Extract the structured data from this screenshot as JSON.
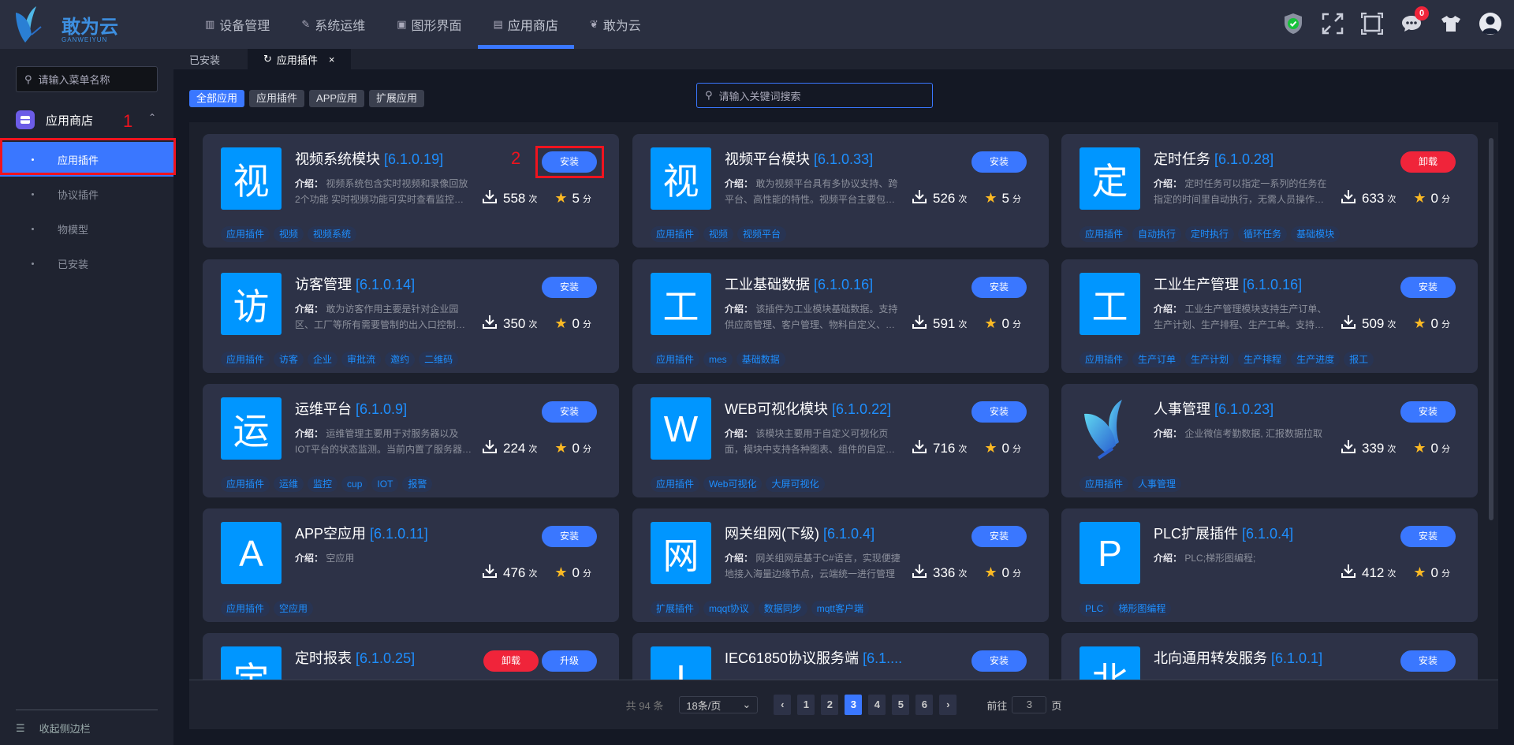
{
  "header": {
    "logo_text": "敢为云",
    "logo_sub": "GANWEIYUN",
    "nav": [
      {
        "label": "设备管理",
        "icon": "device-icon",
        "glyph": "▥"
      },
      {
        "label": "系统运维",
        "icon": "wrench-icon",
        "glyph": "✎"
      },
      {
        "label": "图形界面",
        "icon": "monitor-icon",
        "glyph": "▣"
      },
      {
        "label": "应用商店",
        "icon": "store-icon",
        "glyph": "▤",
        "active": true
      },
      {
        "label": "敢为云",
        "icon": "butterfly-icon",
        "glyph": "❦"
      }
    ],
    "message_count": "0",
    "colors": {
      "accent": "#3a77ff",
      "danger": "#f0243a",
      "tag_text": "#1e8fff",
      "icon_bg": "#0096ff"
    }
  },
  "sidebar": {
    "search_placeholder": "请输入菜单名称",
    "group": "应用商店",
    "items": [
      {
        "label": "应用插件",
        "active": true
      },
      {
        "label": "协议插件"
      },
      {
        "label": "物模型"
      },
      {
        "label": "已安装"
      }
    ],
    "collapse_label": "收起侧边栏"
  },
  "annotations": {
    "one": "1",
    "two": "2"
  },
  "tabs": [
    {
      "label": "已安装"
    },
    {
      "label": "应用插件",
      "active": true
    }
  ],
  "filters": [
    "全部应用",
    "应用插件",
    "APP应用",
    "扩展应用"
  ],
  "search_placeholder": "请输入关键词搜索",
  "labels": {
    "intro": "介绍：",
    "times": "次",
    "score": "分",
    "install": "安装",
    "uninstall": "卸载",
    "upgrade": "升级"
  },
  "plugins": [
    {
      "icon": "视",
      "name": "视频系统模块",
      "version": "[6.1.0.19]",
      "desc": "视频系统包含实时视频和录像回放2个功能 实时视频功能可实时查看监控视频画面",
      "downloads": "558",
      "rating": "5",
      "buttons": [
        "安装"
      ],
      "tags": [
        "应用插件",
        "视频",
        "视频系统"
      ]
    },
    {
      "icon": "视",
      "name": "视频平台模块",
      "version": "[6.1.0.33]",
      "desc": "敢为视频平台具有多协议支持、跨平台、高性能的特性。视频平台主要包含多个模块",
      "downloads": "526",
      "rating": "5",
      "buttons": [
        "安装"
      ],
      "tags": [
        "应用插件",
        "视频",
        "视频平台"
      ]
    },
    {
      "icon": "定",
      "name": "定时任务",
      "version": "[6.1.0.28]",
      "desc": "定时任务可以指定一系列的任务在指定的时间里自动执行，无需人员操作。支持多种",
      "downloads": "633",
      "rating": "0",
      "buttons": [
        "卸载"
      ],
      "tags": [
        "应用插件",
        "自动执行",
        "定时执行",
        "循环任务",
        "基础模块"
      ]
    },
    {
      "icon": "访",
      "name": "访客管理",
      "version": "[6.1.0.14]",
      "desc": "敢为访客作用主要是针对企业园区、工厂等所有需要管制的出入口控制系统",
      "downloads": "350",
      "rating": "0",
      "buttons": [
        "安装"
      ],
      "tags": [
        "应用插件",
        "访客",
        "企业",
        "审批流",
        "邀约",
        "二维码"
      ]
    },
    {
      "icon": "工",
      "name": "工业基础数据",
      "version": "[6.1.0.16]",
      "desc": "该插件为工业模块基础数据。支持供应商管理、客户管理、物料自定义、物料管理",
      "downloads": "591",
      "rating": "0",
      "buttons": [
        "安装"
      ],
      "tags": [
        "应用插件",
        "mes",
        "基础数据"
      ]
    },
    {
      "icon": "工",
      "name": "工业生产管理",
      "version": "[6.1.0.16]",
      "desc": "工业生产管理模块支持生产订单、生产计划、生产排程、生产工单。支持退料管理",
      "downloads": "509",
      "rating": "0",
      "buttons": [
        "安装"
      ],
      "tags": [
        "应用插件",
        "生产订单",
        "生产计划",
        "生产排程",
        "生产进度",
        "报工"
      ]
    },
    {
      "icon": "运",
      "name": "运维平台",
      "version": "[6.1.0.9]",
      "desc": "运维管理主要用于对服务器以及IOT平台的状态监测。当前内置了服务器监控功能",
      "downloads": "224",
      "rating": "0",
      "buttons": [
        "安装"
      ],
      "tags": [
        "应用插件",
        "运维",
        "监控",
        "cup",
        "IOT",
        "报警"
      ]
    },
    {
      "icon": "W",
      "name": "WEB可视化模块",
      "version": "[6.1.0.22]",
      "desc": "该模块主要用于自定义可视化页面，模块中支持各种图表、组件的自定义配置",
      "downloads": "716",
      "rating": "0",
      "buttons": [
        "安装"
      ],
      "tags": [
        "应用插件",
        "Web可视化",
        "大屏可视化"
      ]
    },
    {
      "icon": "",
      "icon_image": "butterfly-logo",
      "name": "人事管理",
      "version": "[6.1.0.23]",
      "desc": "企业微信考勤数据, 汇报数据拉取",
      "downloads": "339",
      "rating": "0",
      "buttons": [
        "安装"
      ],
      "tags": [
        "应用插件",
        "人事管理"
      ]
    },
    {
      "icon": "A",
      "name": "APP空应用",
      "version": "[6.1.0.11]",
      "desc": "空应用",
      "downloads": "476",
      "rating": "0",
      "buttons": [
        "安装"
      ],
      "tags": [
        "应用插件",
        "空应用"
      ]
    },
    {
      "icon": "网",
      "name": "网关组网(下级)",
      "version": "[6.1.0.4]",
      "desc": "网关组网是基于C#语言，实现便捷地接入海量边缘节点，云端统一进行管理",
      "downloads": "336",
      "rating": "0",
      "buttons": [
        "安装"
      ],
      "tags": [
        "扩展插件",
        "mqqt协议",
        "数据同步",
        "mqtt客户端"
      ]
    },
    {
      "icon": "P",
      "name": "PLC扩展插件",
      "version": "[6.1.0.4]",
      "desc": "PLC;梯形图编程;",
      "downloads": "412",
      "rating": "0",
      "buttons": [
        "安装"
      ],
      "tags": [
        "PLC",
        "梯形图编程"
      ]
    },
    {
      "icon": "定",
      "name": "定时报表",
      "version": "[6.1.0.25]",
      "desc": "",
      "downloads": "",
      "rating": "",
      "buttons": [
        "卸载",
        "升级"
      ],
      "tags": []
    },
    {
      "icon": "I",
      "name": "IEC61850协议服务端",
      "version": "[6.1....",
      "desc": "",
      "downloads": "",
      "rating": "",
      "buttons": [
        "安装"
      ],
      "tags": []
    },
    {
      "icon": "北",
      "name": "北向通用转发服务",
      "version": "[6.1.0.1]",
      "desc": "",
      "downloads": "",
      "rating": "",
      "buttons": [
        "安装"
      ],
      "tags": []
    }
  ],
  "pagination": {
    "total": "共 94 条",
    "page_size": "18条/页",
    "pages": [
      "1",
      "2",
      "3",
      "4",
      "5",
      "6"
    ],
    "current": "3",
    "goto_label": "前往",
    "goto_value": "3",
    "page_suffix": "页"
  }
}
